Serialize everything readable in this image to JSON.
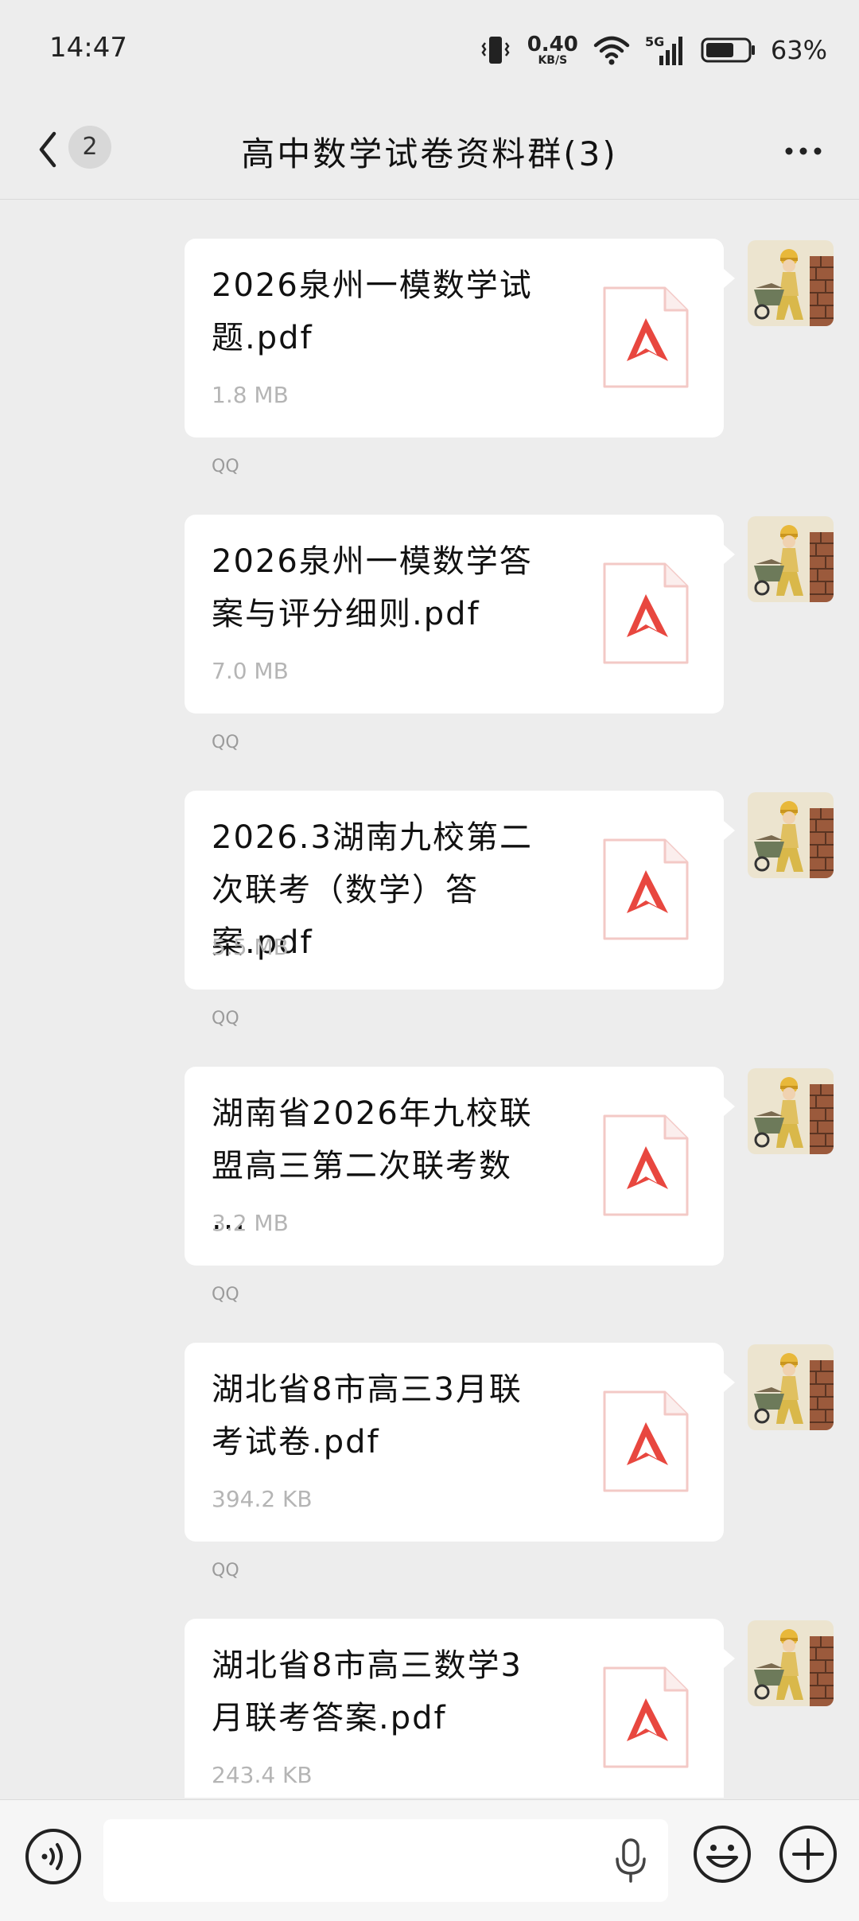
{
  "status_bar": {
    "time": "14:47",
    "net_speed_value": "0.40",
    "net_speed_unit": "KB/S",
    "network": "5G",
    "battery": "63%"
  },
  "header": {
    "unread_count": "2",
    "title": "高中数学试卷资料群(3)"
  },
  "messages": [
    {
      "file_name": "2026泉州一模数学试题.pdf",
      "file_size": "1.8 MB",
      "source": "QQ"
    },
    {
      "file_name": "2026泉州一模数学答案与评分细则.pdf",
      "file_size": "7.0 MB",
      "source": "QQ"
    },
    {
      "file_name": "2026.3湖南九校第二次联考（数学）答案.pdf",
      "file_size": "5.5 MB",
      "source": "QQ"
    },
    {
      "file_name": "湖南省2026年九校联盟高三第二次联考数 ...",
      "file_size": "3.2 MB",
      "source": "QQ"
    },
    {
      "file_name": "湖北省8市高三3月联考试卷.pdf",
      "file_size": "394.2 KB",
      "source": "QQ"
    },
    {
      "file_name": "湖北省8市高三数学3月联考答案.pdf",
      "file_size": "243.4 KB",
      "source": ""
    }
  ],
  "input_bar": {
    "placeholder": ""
  },
  "colors": {
    "pdf_red": "#e8473f",
    "background": "#ededed",
    "bubble": "#ffffff"
  },
  "icons": [
    "back-icon",
    "more-icon",
    "pdf-icon",
    "voice-icon",
    "mic-icon",
    "emoji-icon",
    "plus-icon",
    "wifi-icon",
    "signal-icon",
    "battery-icon",
    "vibrate-icon"
  ]
}
